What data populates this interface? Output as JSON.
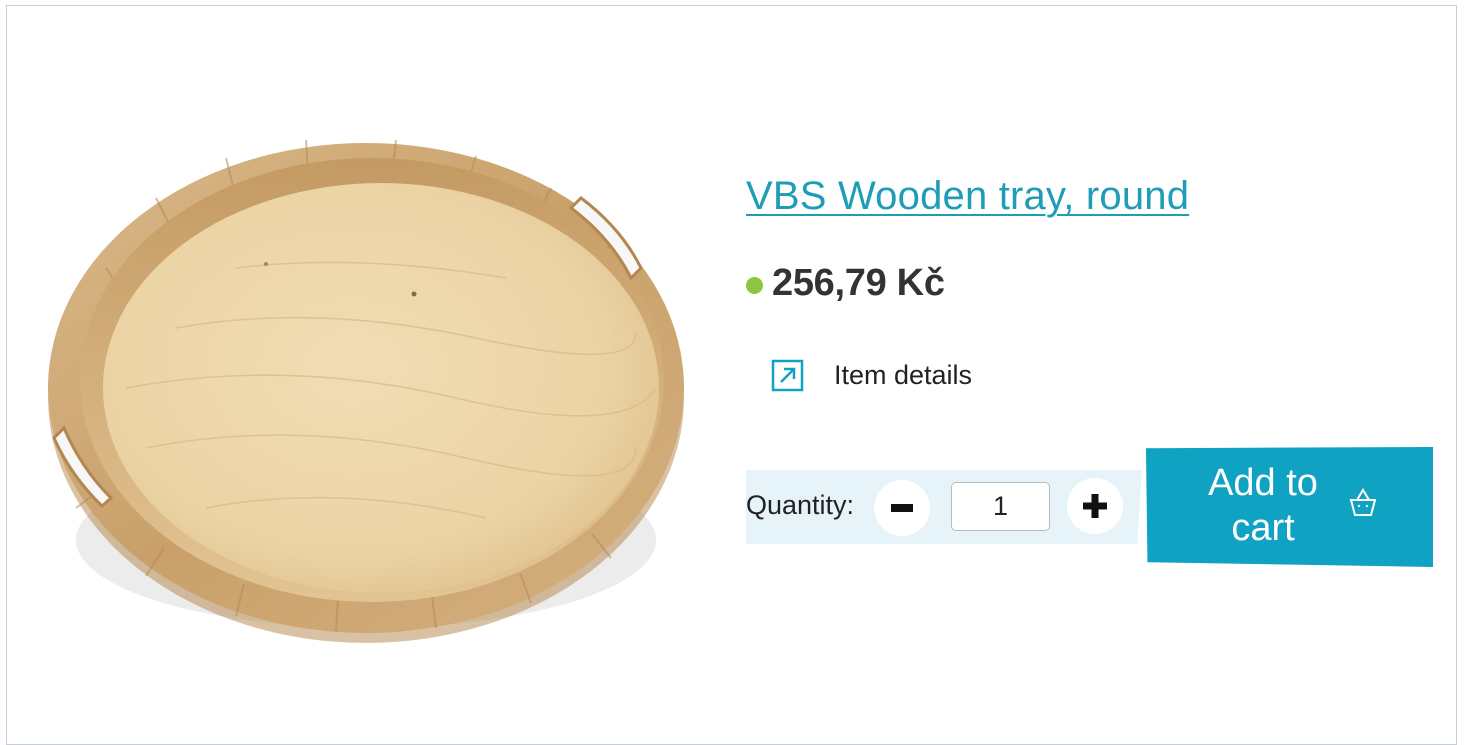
{
  "product": {
    "title": "VBS Wooden tray, round",
    "price": "256,79 Kč",
    "details_label": "Item details",
    "image_subject": "round wooden tray with handle cutouts"
  },
  "quantity": {
    "label": "Quantity:",
    "value": "1",
    "minus_icon": "minus-icon",
    "plus_icon": "plus-icon"
  },
  "cart": {
    "button_label": "Add to cart",
    "icon": "basket-icon"
  },
  "colors": {
    "accent": "#10a2c3",
    "title_link": "#1e9db7",
    "stock_ok": "#8cc63f",
    "quantity_bg": "#e6f4f9",
    "text": "#333333"
  }
}
